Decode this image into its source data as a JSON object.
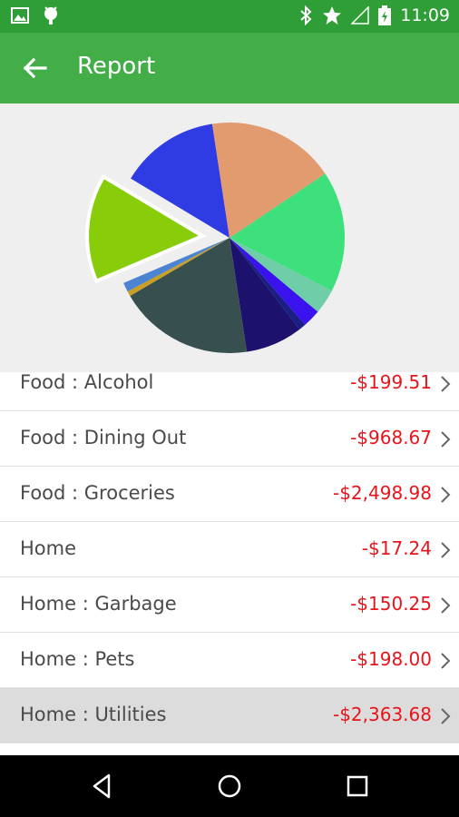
{
  "status_bar": {
    "time": "11:09",
    "left_icons": [
      "image-icon",
      "android-icon"
    ],
    "right_icons": [
      "bluetooth-icon",
      "star-icon",
      "signal-icon",
      "battery-icon"
    ]
  },
  "app_bar": {
    "title": "Report",
    "back_icon": "back-arrow-icon",
    "color": "#43ad48"
  },
  "chart_data": {
    "type": "pie",
    "title": "",
    "exploded_slice_color": "#88cc0a",
    "slices": [
      {
        "value": 17.0,
        "color": "#3de07a"
      },
      {
        "value": 3.5,
        "color": "#6fcea8"
      },
      {
        "value": 2.5,
        "color": "#3a12ee"
      },
      {
        "value": 1.0,
        "color": "#1a1f86"
      },
      {
        "value": 8.0,
        "color": "#1d116e"
      },
      {
        "value": 19.0,
        "color": "#37504f"
      },
      {
        "value": 0.7,
        "color": "#caa022"
      },
      {
        "value": 1.3,
        "color": "#4d84d2"
      },
      {
        "value": 15.0,
        "color": "#88cc0a"
      },
      {
        "value": 14.0,
        "color": "#2f3be3"
      },
      {
        "value": 18.0,
        "color": "#e19b6f"
      }
    ]
  },
  "list": {
    "amount_color": "#e8141b",
    "rows": [
      {
        "label": "Food : Alcohol",
        "amount": "-$199.51"
      },
      {
        "label": "Food : Dining Out",
        "amount": "-$968.67"
      },
      {
        "label": "Food : Groceries",
        "amount": "-$2,498.98"
      },
      {
        "label": "Home",
        "amount": "-$17.24"
      },
      {
        "label": "Home : Garbage",
        "amount": "-$150.25"
      },
      {
        "label": "Home : Pets",
        "amount": "-$198.00"
      },
      {
        "label": "Home : Utilities",
        "amount": "-$2,363.68"
      }
    ]
  },
  "nav_bar": {
    "buttons": [
      "back-triangle-icon",
      "home-circle-icon",
      "recents-square-icon"
    ]
  }
}
